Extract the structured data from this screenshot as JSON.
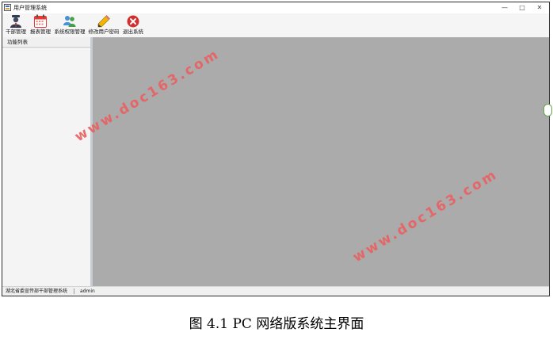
{
  "window": {
    "title": "用户管理系统",
    "controls": {
      "minimize": "—",
      "maximize": "□",
      "close": "✕"
    }
  },
  "toolbar": {
    "items": [
      {
        "label": "干部管理",
        "icon": "cadre-user-icon"
      },
      {
        "label": "报表管理",
        "icon": "calendar-report-icon"
      },
      {
        "label": "系统权限管理",
        "icon": "users-permission-icon"
      },
      {
        "label": "修改用户密码",
        "icon": "pencil-edit-icon"
      },
      {
        "label": "退出系统",
        "icon": "exit-red-icon"
      }
    ]
  },
  "sidebar": {
    "header": "功能列表"
  },
  "statusbar": {
    "org": "湖北省委宣传部干部管理系统",
    "user": "admin"
  },
  "watermark": "www.doc163.com",
  "caption": "图 4.1 PC 网络版系统主界面",
  "colors": {
    "main_area": "#ababab",
    "watermark": "#e96060",
    "exit_icon": "#d32f2f",
    "calendar_icon": "#e53935"
  }
}
